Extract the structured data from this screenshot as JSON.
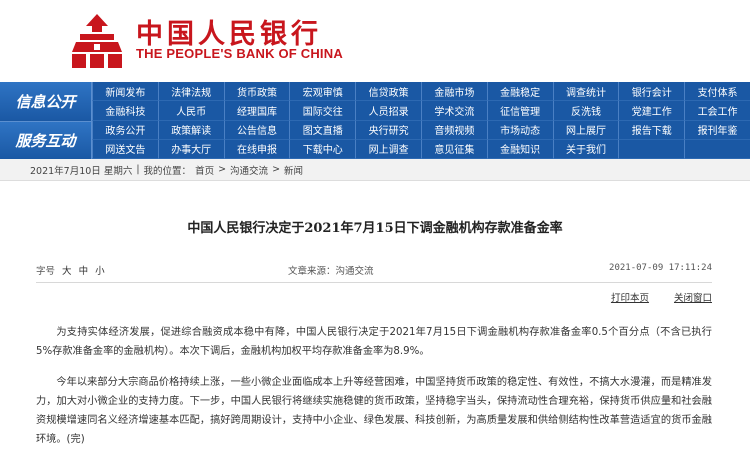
{
  "header": {
    "logo_cn": "中国人民银行",
    "logo_en": "THE PEOPLE'S BANK OF CHINA"
  },
  "nav": {
    "block1_label": "信息公开",
    "block2_label": "服务互动",
    "rows": [
      [
        "新闻发布",
        "法律法规",
        "货币政策",
        "宏观审慎",
        "信贷政策",
        "金融市场",
        "金融稳定",
        "调查统计",
        "银行会计",
        "支付体系"
      ],
      [
        "金融科技",
        "人民币",
        "经理国库",
        "国际交往",
        "人员招录",
        "学术交流",
        "征信管理",
        "反洗钱",
        "党建工作",
        "工会工作"
      ],
      [
        "政务公开",
        "政策解读",
        "公告信息",
        "图文直播",
        "央行研究",
        "音频视频",
        "市场动态",
        "网上展厅",
        "报告下载",
        "报刊年鉴"
      ],
      [
        "网送文告",
        "办事大厅",
        "在线申报",
        "下载中心",
        "网上调查",
        "意见征集",
        "金融知识",
        "关于我们",
        "",
        ""
      ]
    ]
  },
  "breadcrumb": {
    "date": "2021年7月10日 星期六",
    "sep": "|",
    "location_label": "我的位置：",
    "items": [
      "首页",
      "沟通交流",
      "新闻"
    ],
    "arrow": ">"
  },
  "article": {
    "title": "中国人民银行决定于2021年7月15日下调金融机构存款准备金率",
    "font_label": "字号",
    "font_sizes": [
      "大",
      "中",
      "小"
    ],
    "source": "文章来源：沟通交流",
    "date": "2021-07-09 17:11:24",
    "print_label": "打印本页",
    "close_label": "关闭窗口",
    "paragraphs": [
      "为支持实体经济发展，促进综合融资成本稳中有降，中国人民银行决定于2021年7月15日下调金融机构存款准备金率0.5个百分点（不含已执行5%存款准备金率的金融机构）。本次下调后，金融机构加权平均存款准备金率为8.9%。",
      "今年以来部分大宗商品价格持续上涨，一些小微企业面临成本上升等经营困难，中国坚持货币政策的稳定性、有效性，不搞大水漫灌，而是精准发力，加大对小微企业的支持力度。下一步，中国人民银行将继续实施稳健的货币政策，坚持稳字当头，保持流动性合理充裕，保持货币供应量和社会融资规模增速同名义经济增速基本匹配，搞好跨周期设计，支持中小企业、绿色发展、科技创新，为高质量发展和供给侧结构性改革营造适宜的货币金融环境。(完)"
    ]
  },
  "colors": {
    "brand_red": "#c8161d",
    "nav_blue": "#1a58a4"
  }
}
